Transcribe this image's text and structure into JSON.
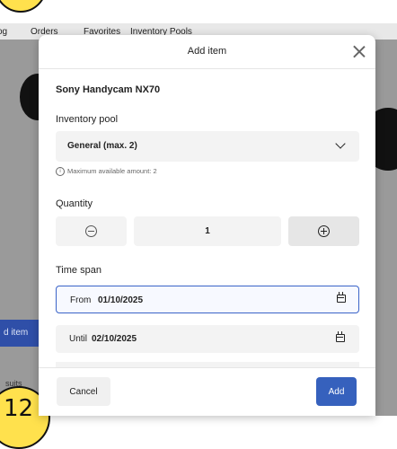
{
  "background": {
    "nav": [
      "og",
      "Orders",
      "Favorites",
      "Inventory Pools"
    ],
    "side_button_label": "d item",
    "corner_text": "suits",
    "corner_badge": "12"
  },
  "modal": {
    "title": "Add item",
    "product_name": "Sony Handycam NX70",
    "inventory_pool": {
      "label": "Inventory pool",
      "selected": "General (max. 2)",
      "hint": "Maximum available amount: 2"
    },
    "quantity": {
      "label": "Quantity",
      "value": "1"
    },
    "time_span": {
      "label": "Time span",
      "from_label": "From",
      "from_value": "01/10/2025",
      "until_label": "Until",
      "until_value": "02/10/2025"
    },
    "footer": {
      "cancel_label": "Cancel",
      "add_label": "Add"
    }
  },
  "colors": {
    "primary": "#3661bd",
    "accent_yellow": "#ffe14d",
    "focus_border": "#3a63c8"
  },
  "icons": {
    "close": "close-icon",
    "chevron": "chevron-down-icon",
    "info": "info-icon",
    "minus": "minus-circle-icon",
    "plus": "plus-circle-icon",
    "calendar": "calendar-icon"
  }
}
